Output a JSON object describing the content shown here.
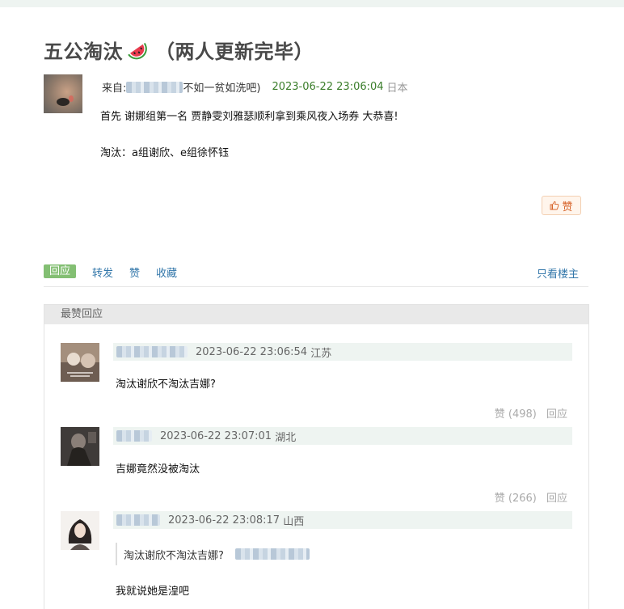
{
  "post": {
    "title": "五公淘汰",
    "title_suffix": "（两人更新完毕）",
    "from_label": "来自:",
    "author_suffix": "不如一贫如洗吧)",
    "timestamp": "2023-06-22 23:06:04",
    "location": "日本",
    "body": [
      "首先 谢娜组第一名 贾静雯刘雅瑟顺利拿到乘风夜入场券 大恭喜!",
      "淘汰：a组谢欣、e组徐怀钰"
    ],
    "like_label": "赞"
  },
  "actions": {
    "reply": "回应",
    "forward": "转发",
    "like": "赞",
    "collect": "收藏",
    "only_op": "只看楼主"
  },
  "best_comments": {
    "header": "最赞回应",
    "items": [
      {
        "timestamp": "2023-06-22 23:06:54",
        "location": "江苏",
        "text": "淘汰谢欣不淘汰吉娜?",
        "like_label": "赞 (498)",
        "reply_label": "回应"
      },
      {
        "timestamp": "2023-06-22 23:07:01",
        "location": "湖北",
        "text": "吉娜竟然没被淘汰",
        "like_label": "赞 (266)",
        "reply_label": "回应"
      },
      {
        "timestamp": "2023-06-22 23:08:17",
        "location": "山西",
        "quote": "淘汰谢欣不淘汰吉娜?",
        "text": "我就说她是湟吧"
      }
    ]
  },
  "colors": {
    "accent_green": "#83bf73",
    "link_blue": "#3377aa",
    "timestamp_green": "#3a7d2a",
    "like_orange": "#d7642a"
  }
}
